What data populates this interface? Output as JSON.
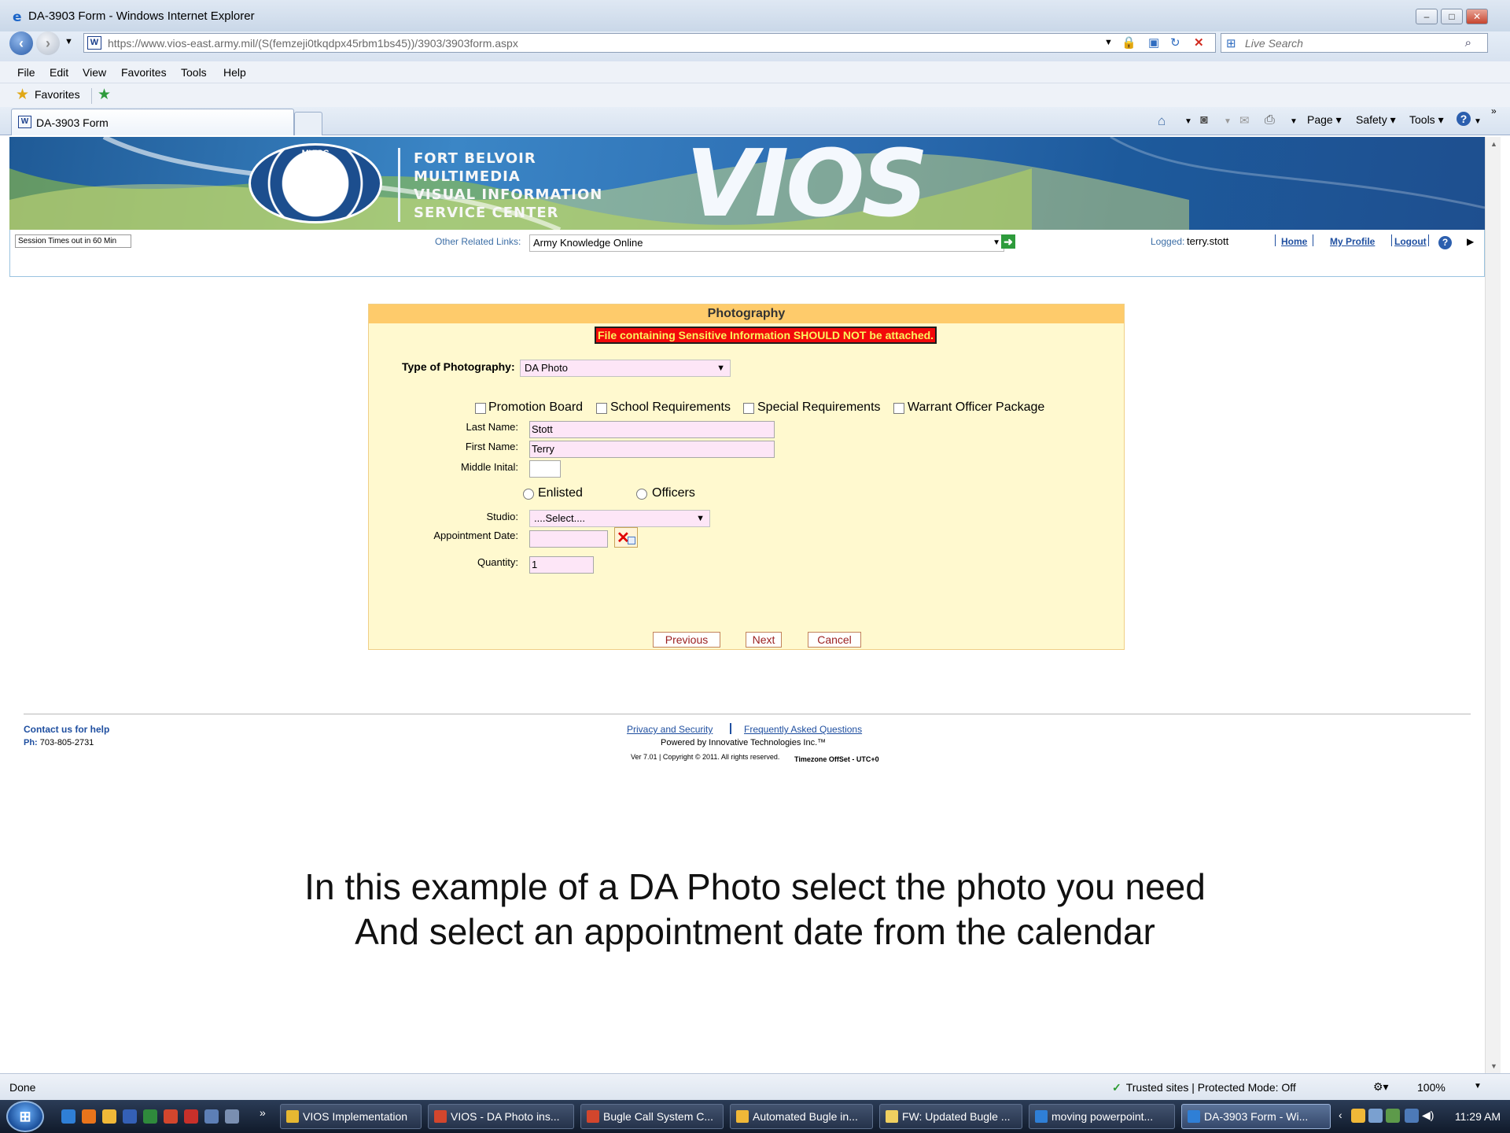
{
  "window": {
    "title": "DA-3903 Form - Windows Internet Explorer",
    "controls": [
      "–",
      "□",
      "✕"
    ]
  },
  "address_bar": {
    "url": "https://www.vios-east.army.mil/(S(femzeji0tkqdpx45rbm1bs45))/3903/3903form.aspx",
    "search_placeholder": "Live Search"
  },
  "menu": [
    "File",
    "Edit",
    "View",
    "Favorites",
    "Tools",
    "Help"
  ],
  "favorites_bar": {
    "label": "Favorites"
  },
  "tab": {
    "label": "DA-3903 Form"
  },
  "command_bar": {
    "page": "Page ▾",
    "safety": "Safety ▾",
    "tools": "Tools ▾"
  },
  "banner": {
    "org_lines": [
      "FORT BELVOIR",
      "MULTIMEDIA",
      "VISUAL INFORMATION",
      "SERVICE CENTER"
    ],
    "seal_text": "MVISC",
    "brand": "VIOS"
  },
  "topbar": {
    "session": "Session Times out in 60 Min",
    "related_label": "Other Related Links:",
    "related_value": "Army Knowledge Online",
    "logged_label": "Logged:",
    "logged_user": "terry.stott",
    "home": "Home",
    "profile": "My Profile",
    "logout": "Logout"
  },
  "form": {
    "heading": "Photography",
    "warning": "File containing Sensitive Information SHOULD NOT be attached.",
    "type_label": "Type of Photography:",
    "type_value": "DA Photo",
    "checkboxes": [
      "Promotion Board",
      "School Requirements",
      "Special Requirements",
      "Warrant Officer Package"
    ],
    "last_name_label": "Last Name:",
    "last_name": "Stott",
    "first_name_label": "First Name:",
    "first_name": "Terry",
    "middle_label": "Middle Inital:",
    "middle": "",
    "radios": [
      "Enlisted",
      "Officers"
    ],
    "studio_label": "Studio:",
    "studio_value": "....Select....",
    "appointment_label": "Appointment Date:",
    "appointment_value": "",
    "quantity_label": "Quantity:",
    "quantity": "1",
    "buttons": {
      "previous": "Previous",
      "next": "Next",
      "cancel": "Cancel"
    }
  },
  "footer": {
    "contact": "Contact us for help",
    "phone_label": "Ph:",
    "phone": "703-805-2731",
    "privacy": "Privacy and Security",
    "faq": "Frequently Asked Questions",
    "powered": "Powered by Innovative Technologies Inc.™",
    "version": "Ver 7.01 | Copyright © 2011. All rights reserved.",
    "timezone": "Timezone OffSet - UTC+0"
  },
  "caption": {
    "line1": "In this example of a DA Photo select the photo you need",
    "line2": "And select an appointment date from the calendar"
  },
  "statusbar": {
    "status": "Done",
    "zone": "Trusted sites | Protected Mode: Off",
    "zoom": "100%"
  },
  "taskbar": {
    "items": [
      "VIOS Implementation",
      "VIOS - DA Photo ins...",
      "Bugle Call System C...",
      "Automated Bugle in...",
      "FW: Updated Bugle ...",
      "moving powerpoint...",
      "DA-3903 Form - Wi..."
    ],
    "clock": "11:29 AM"
  }
}
